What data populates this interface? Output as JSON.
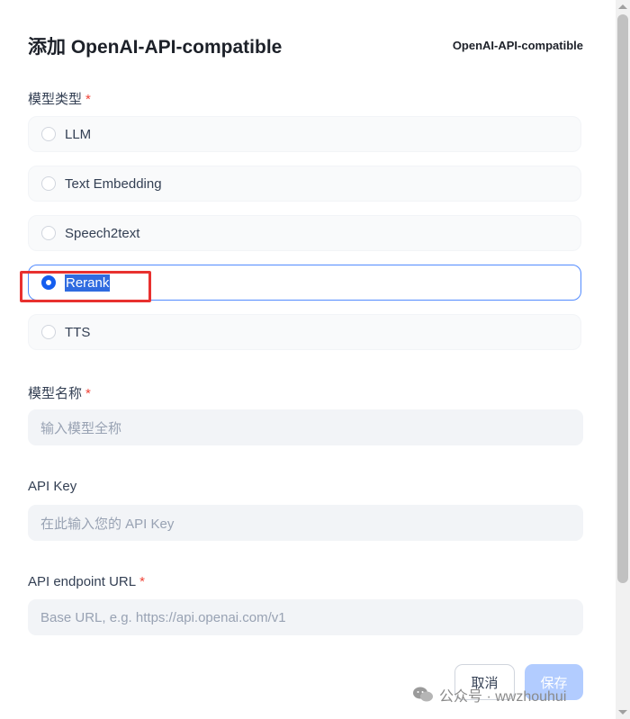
{
  "dialog": {
    "title": "添加 OpenAI-API-compatible",
    "provider": "OpenAI-API-compatible"
  },
  "model_type": {
    "label": "模型类型",
    "required": "*",
    "options": [
      "LLM",
      "Text Embedding",
      "Speech2text",
      "Rerank",
      "TTS"
    ],
    "selected": "Rerank"
  },
  "model_name": {
    "label": "模型名称",
    "required": "*",
    "placeholder": "输入模型全称"
  },
  "api_key": {
    "label": "API Key",
    "placeholder": "在此输入您的 API Key"
  },
  "endpoint": {
    "label": "API endpoint URL",
    "required": "*",
    "placeholder": "Base URL, e.g. https://api.openai.com/v1"
  },
  "buttons": {
    "cancel": "取消",
    "save": "保存"
  },
  "watermark": {
    "text": "公众号 · wwzhouhui"
  },
  "colors": {
    "accent": "#155eef",
    "highlight_border": "#e8312f",
    "required": "#f04438"
  }
}
